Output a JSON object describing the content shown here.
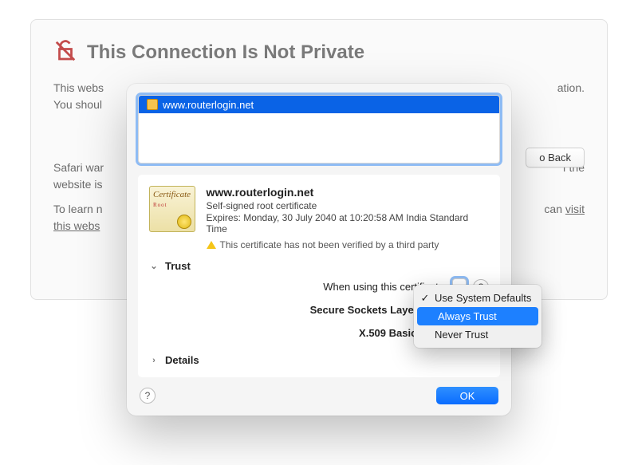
{
  "warning": {
    "title": "This Connection Is Not Private",
    "para1_prefix": "This webs",
    "para1_suffix": "ation.",
    "para2_prefix": "You shoul",
    "para3_prefix": "Safari war",
    "para3_suffix_a": "f the",
    "para4_prefix": "website is",
    "para5_prefix": "To learn n",
    "para5_suffix": "can ",
    "visit": "visit",
    "this_website": "this webs",
    "go_back": "Go Back",
    "go_back_visible": "o Back"
  },
  "dialog": {
    "tree_item": "www.routerlogin.net",
    "cert_name": "www.routerlogin.net",
    "cert_type": "Self-signed root certificate",
    "cert_expires": "Expires: Monday, 30 July 2040 at 10:20:58 AM India Standard Time",
    "cert_warning": "This certificate has not been verified by a third party",
    "trust_label": "Trust",
    "when_using": "When using this certificate",
    "ssl_label": "Secure Sockets Layer (SSL",
    "x509_label": "X.509 Basic Polic",
    "details_label": "Details",
    "ok": "OK",
    "cert_badge": "Certificate",
    "cert_root": "Root"
  },
  "popover": {
    "opt1": "Use System Defaults",
    "opt2": "Always Trust",
    "opt3": "Never Trust"
  }
}
